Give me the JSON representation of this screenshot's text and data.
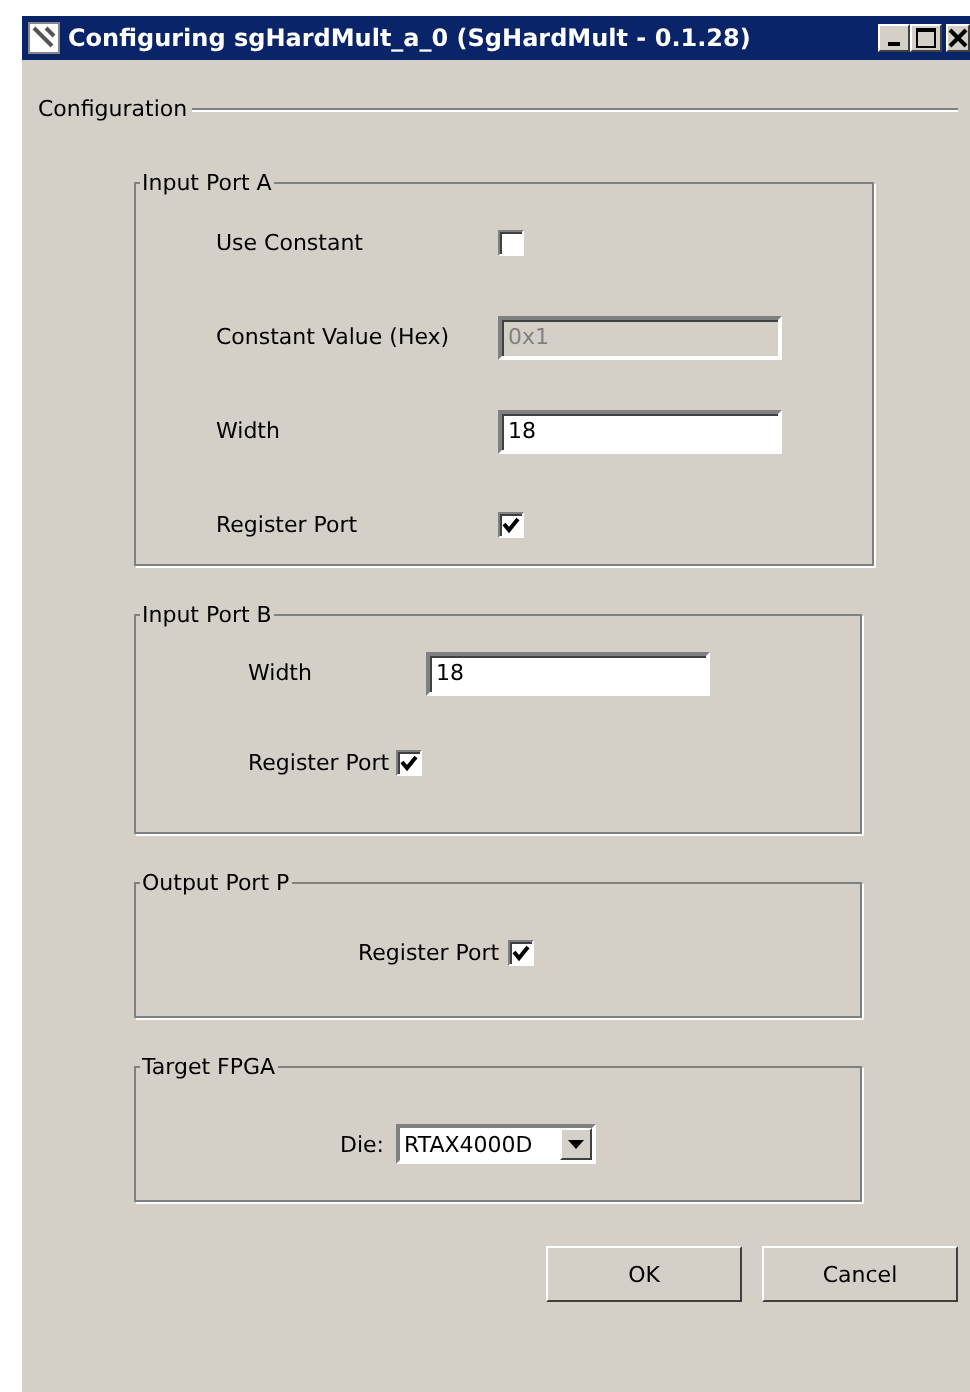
{
  "window": {
    "title": "Configuring sgHardMult_a_0 (SgHardMult - 0.1.28)"
  },
  "section": {
    "title": "Configuration"
  },
  "groups": [
    {
      "title": "Input Port A",
      "rows": [
        {
          "kind": "checkbox",
          "label": "Use Constant",
          "checked": false
        },
        {
          "kind": "text",
          "label": "Constant Value (Hex)",
          "value": "0x1",
          "disabled": true
        },
        {
          "kind": "text",
          "label": "Width",
          "value": "18",
          "disabled": false
        },
        {
          "kind": "checkbox",
          "label": "Register Port",
          "checked": true
        }
      ]
    },
    {
      "title": "Input Port B",
      "rows": [
        {
          "kind": "text",
          "label": "Width",
          "value": "18",
          "disabled": false
        },
        {
          "kind": "checkbox",
          "label": "Register Port",
          "checked": true
        }
      ]
    },
    {
      "title": "Output Port P",
      "rows": [
        {
          "kind": "checkbox",
          "label": "Register Port",
          "checked": true
        }
      ]
    },
    {
      "title": "Target FPGA",
      "rows": [
        {
          "kind": "select",
          "label": "Die:",
          "value": "RTAX4000D"
        }
      ]
    }
  ],
  "buttons": [
    "OK",
    "Cancel"
  ]
}
